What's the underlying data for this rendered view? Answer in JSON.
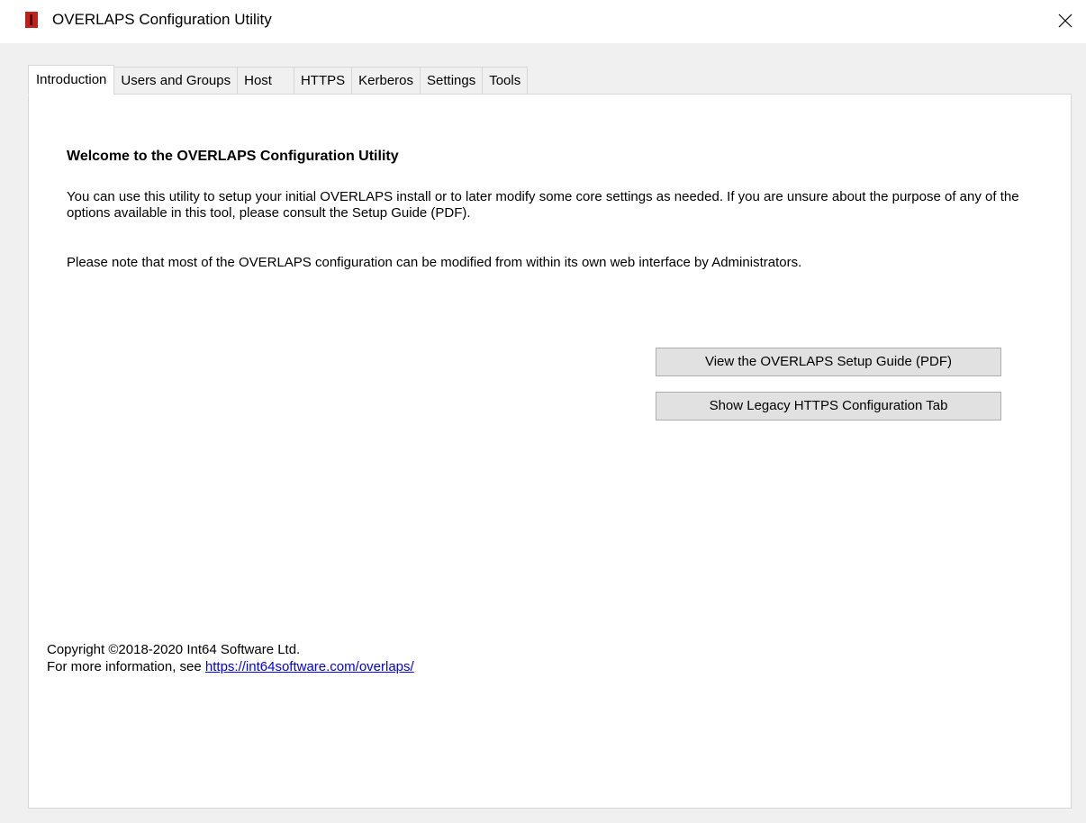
{
  "window": {
    "title": "OVERLAPS Configuration Utility",
    "icon": "overlaps-app-icon",
    "accent": "#c0201a"
  },
  "tabs": [
    {
      "label": "Introduction",
      "active": true
    },
    {
      "label": "Users and Groups",
      "active": false
    },
    {
      "label": "Host",
      "active": false
    },
    {
      "label": "HTTPS",
      "active": false
    },
    {
      "label": "Kerberos",
      "active": false
    },
    {
      "label": "Settings",
      "active": false
    },
    {
      "label": "Tools",
      "active": false
    }
  ],
  "intro": {
    "heading": "Welcome to the OVERLAPS Configuration Utility",
    "paragraph1": "You can use this utility to setup your initial OVERLAPS install or to later modify some core settings as needed. If you are unsure about the purpose of any of the options available in this tool, please consult the Setup Guide (PDF).",
    "paragraph2": "Please note that most of the OVERLAPS configuration can be modified from within its own web interface by Administrators.",
    "button_guide": "View the OVERLAPS Setup Guide (PDF)",
    "button_legacy": "Show Legacy HTTPS Configuration Tab"
  },
  "footer": {
    "copyright": "Copyright ©2018-2020 Int64 Software Ltd.",
    "more_info": "For more information, see",
    "link": "https://int64software.com/overlaps/"
  }
}
